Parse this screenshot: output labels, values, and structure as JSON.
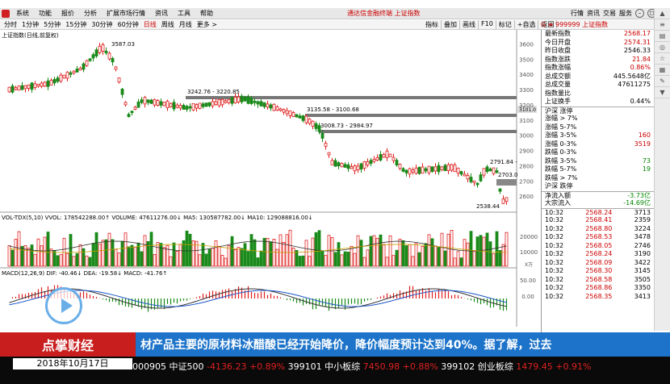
{
  "menu": [
    "系统",
    "功能",
    "报价",
    "分析",
    "扩展市场行情",
    "资讯",
    "工具",
    "帮助"
  ],
  "top_center": "通达信金融终端   上证指数",
  "top_right": [
    "行情",
    "资讯",
    "交易",
    "服务"
  ],
  "periods": [
    "分时",
    "1分钟",
    "5分钟",
    "15分钟",
    "30分钟",
    "60分钟",
    "日线",
    "周线",
    "月线",
    "更多 >"
  ],
  "active_period": "日线",
  "tools": [
    "指标",
    "叠加",
    "画线",
    "F10",
    "标记",
    "+自选",
    "返回"
  ],
  "code_header": "G ≡ 999999 上证指数",
  "chart_title": "上证指数(日线,前复权)",
  "price_axis": [
    "3600",
    "3500",
    "3400",
    "3300",
    "3200",
    "3100",
    "3000",
    "2900",
    "2800",
    "2700",
    "2600"
  ],
  "annotations": {
    "high": "3587.03",
    "r1": "3242.76 - 3220.85",
    "r2": "3135.58 - 3100.68",
    "r3": "3008.73 - 2984.97",
    "r4": "2791.84 -",
    "r5": "2703.0",
    "low": "2538.44",
    "cur": "3101.0"
  },
  "vol_label": "VOL-TDX(5,10) VVOL: 178542288.00↑  VOLUME: 47611276.00↓  MA5: 130587782.00↓  MA10: 129088816.00↓",
  "vol_axis": [
    "20000",
    "10000"
  ],
  "vol_unit": "X万",
  "macd_label": "MACD(12,26,9) DIF: -40.46↓  DEA: -19.58↓  MACD: -41.76↑",
  "macd_axis": [
    "50.00",
    "0.00"
  ],
  "quote": [
    {
      "k": "最新指数",
      "v": "2568.17",
      "c": "v"
    },
    {
      "k": "今日开盘",
      "v": "2574.31",
      "c": "v"
    },
    {
      "k": "昨日收盘",
      "v": "2546.33",
      "c": ""
    },
    {
      "k": "指数涨跌",
      "v": "21.84",
      "c": "v"
    },
    {
      "k": "指数涨幅",
      "v": "0.86%",
      "c": "v"
    },
    {
      "k": "总成交额",
      "v": "445.5648亿",
      "c": ""
    },
    {
      "k": "总成交量",
      "v": "47611275",
      "c": ""
    },
    {
      "k": "指数量比",
      "v": "",
      "c": ""
    },
    {
      "k": "上证换手",
      "v": "0.44%",
      "c": ""
    }
  ],
  "breadth": [
    {
      "k": "沪深 涨停",
      "v": "",
      "c": "v"
    },
    {
      "k": "涨幅 > 7%",
      "v": "",
      "c": "v"
    },
    {
      "k": "涨幅 5-7%",
      "v": "",
      "c": "v"
    },
    {
      "k": "涨幅 3-5%",
      "v": "160",
      "c": "v"
    },
    {
      "k": "涨幅 0-3%",
      "v": "3519",
      "c": "v"
    },
    {
      "k": "跌幅 0-3%",
      "v": "",
      "c": "g"
    },
    {
      "k": "跌幅 3-5%",
      "v": "73",
      "c": "g"
    },
    {
      "k": "跌幅 5-7%",
      "v": "19",
      "c": "g"
    },
    {
      "k": "跌幅 > 7%",
      "v": "",
      "c": "g"
    },
    {
      "k": "沪深 跌停",
      "v": "",
      "c": "g"
    }
  ],
  "flows": [
    {
      "k": "净流入额",
      "v": "-3.73亿",
      "c": "g"
    },
    {
      "k": "大宗流入",
      "v": "-14.69亿",
      "c": "g"
    }
  ],
  "ticks": [
    {
      "t": "10:32",
      "p": "2568.24",
      "q": "3713"
    },
    {
      "t": "10:32",
      "p": "2568.41",
      "q": "2359"
    },
    {
      "t": "10:32",
      "p": "2568.80",
      "q": "3224"
    },
    {
      "t": "10:32",
      "p": "2568.53",
      "q": "3478"
    },
    {
      "t": "10:32",
      "p": "2568.05",
      "q": "2746"
    },
    {
      "t": "10:32",
      "p": "2568.24",
      "q": "3190"
    },
    {
      "t": "10:32",
      "p": "2568.09",
      "q": "3422"
    },
    {
      "t": "10:32",
      "p": "2568.30",
      "q": "3145"
    },
    {
      "t": "10:32",
      "p": "2568.58",
      "q": "3505"
    },
    {
      "t": "10:32",
      "p": "2568.86",
      "q": "3350"
    },
    {
      "t": "10:32",
      "p": "2568.35",
      "q": "3413"
    }
  ],
  "banner_brand": "点掌财经",
  "banner_news": "材产品主要的原材料冰醋酸已经开始降价，降价幅度预计达到40%。据了解，过去",
  "date": "2018年10月17日",
  "ticker": [
    {
      "code": "000905",
      "name": "中证500",
      "pct": "-4136.23 +0.89%"
    },
    {
      "code": "399101",
      "name": "中小板综",
      "pct": "7450.98 +0.88%"
    },
    {
      "code": "399102",
      "name": "创业板综",
      "pct": "1479.45 +0.91%"
    }
  ],
  "colors": {
    "up": "#e02020",
    "down": "#1a8a1a",
    "bg": "#ffffff",
    "banner": "#1c73c9",
    "brand": "#c81e1e"
  }
}
